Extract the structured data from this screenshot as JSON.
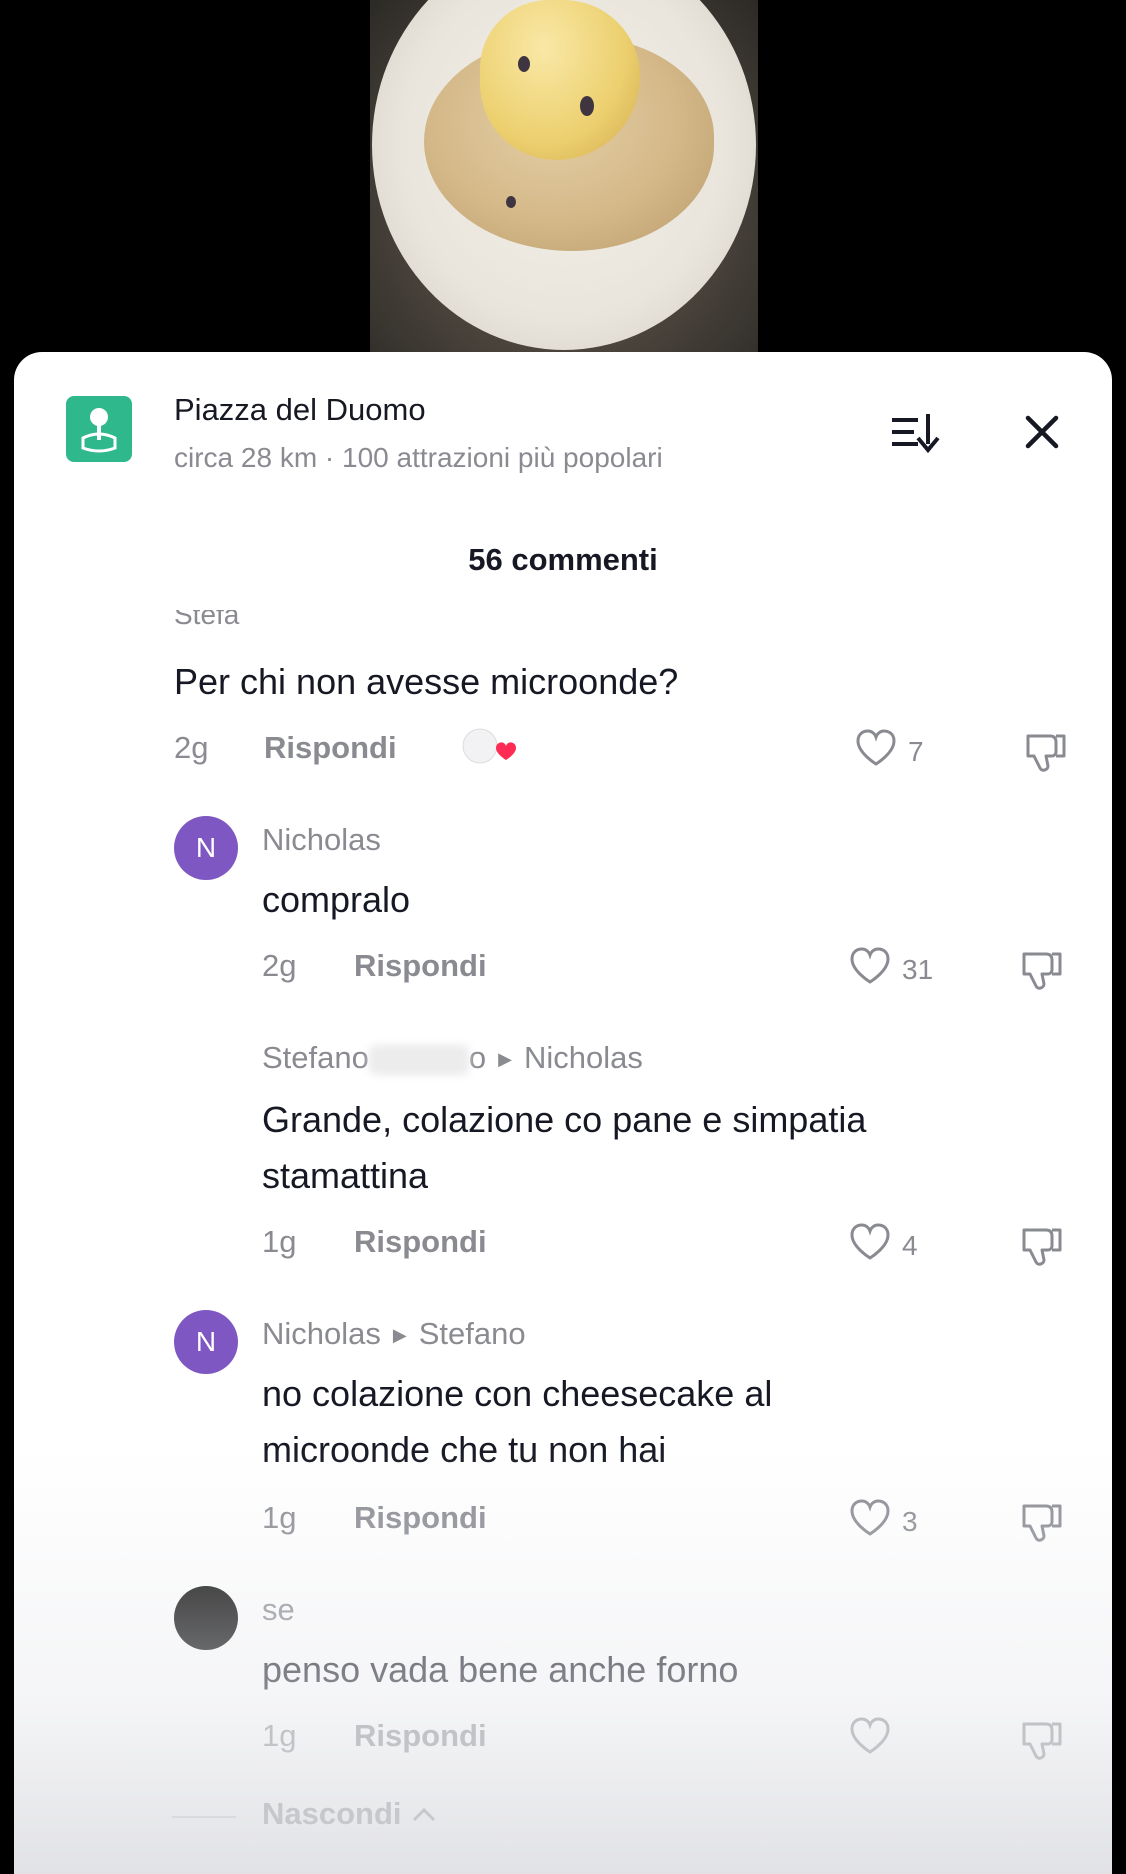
{
  "location": {
    "title": "Piazza del Duomo",
    "subtitle": "circa 28 km · 100 attrazioni più popolari"
  },
  "comments_count": "56 commenti",
  "cut_username": "Stefa",
  "comments": [
    {
      "text": "Per chi non avesse microonde?",
      "time": "2g",
      "reply": "Rispondi",
      "likes": "7"
    },
    {
      "avatar": "N",
      "name": "Nicholas",
      "text": "compralo",
      "time": "2g",
      "reply": "Rispondi",
      "likes": "31"
    },
    {
      "name_from": "Stefano",
      "name_suffix": "o",
      "name_to": "Nicholas",
      "text_line1": "Grande, colazione co pane e simpatia",
      "text_line2": "stamattina",
      "time": "1g",
      "reply": "Rispondi",
      "likes": "4"
    },
    {
      "avatar": "N",
      "name_from": "Nicholas",
      "name_to": "Stefano",
      "text_line1": "no colazione con cheesecake al",
      "text_line2": "microonde che tu non hai",
      "time": "1g",
      "reply": "Rispondi",
      "likes": "3"
    },
    {
      "name": "se",
      "text": "penso vada bene anche forno",
      "time": "1g",
      "reply": "Rispondi",
      "likes": ""
    }
  ],
  "hide_label": "Nascondi",
  "colors": {
    "accent_green": "#2fb88c",
    "avatar_purple": "#7e57c2",
    "heart_red": "#fe2c55"
  }
}
